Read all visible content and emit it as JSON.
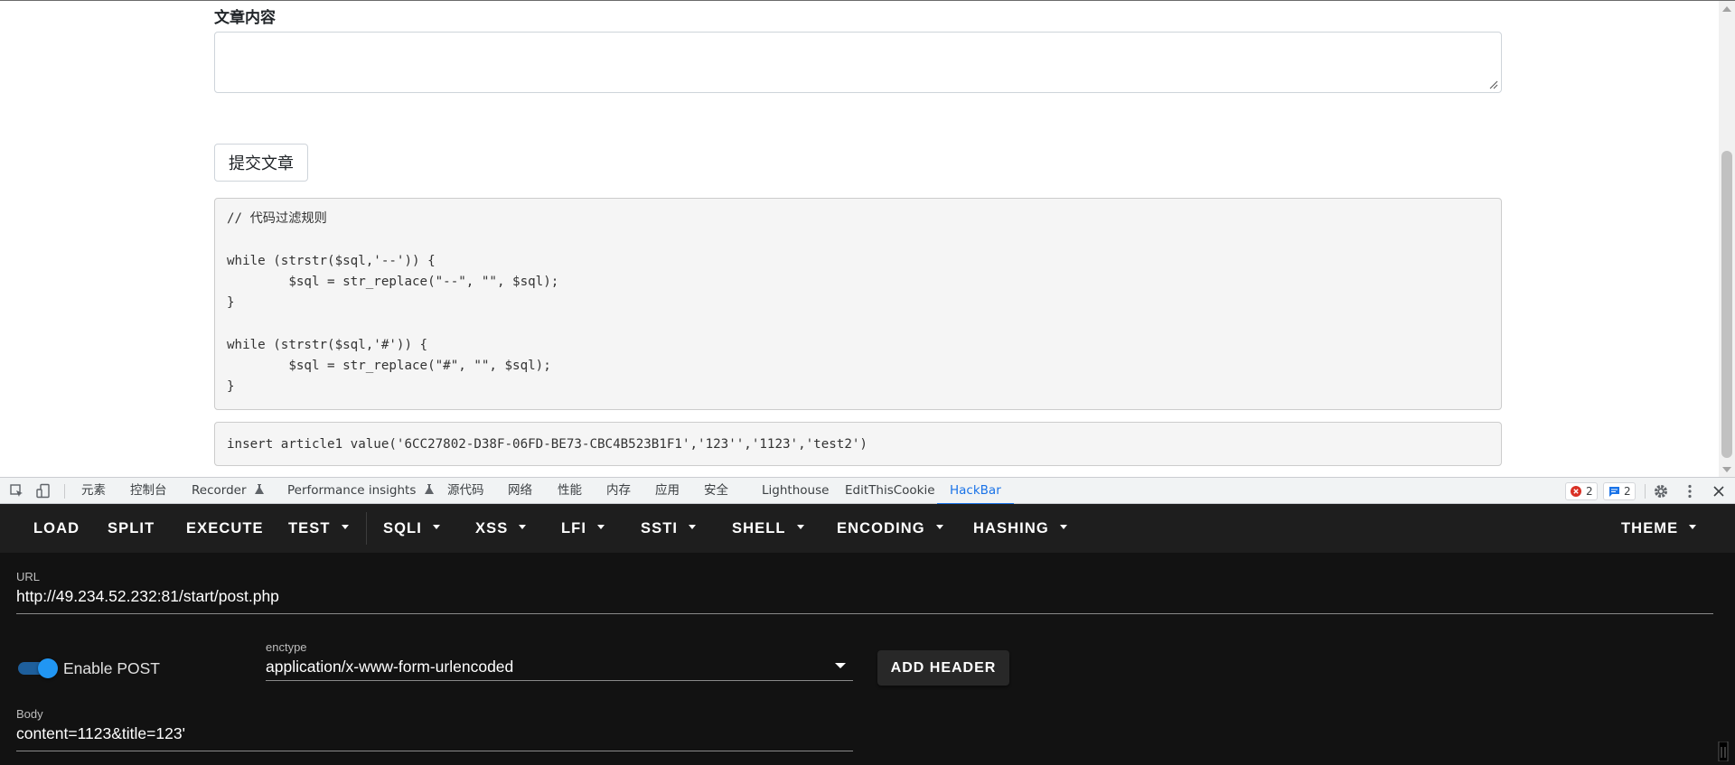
{
  "page": {
    "content_label": "文章内容",
    "content_value": "",
    "submit_label": "提交文章",
    "code_rules": "// 代码过滤规则\n\nwhile (strstr($sql,'--')) {\n        $sql = str_replace(\"--\", \"\", $sql);\n}\n\nwhile (strstr($sql,'#')) {\n        $sql = str_replace(\"#\", \"\", $sql);\n}",
    "sql_query": "insert article1 value('6CC27802-D38F-06FD-BE73-CBC4B523B1F1','123'','1123','test2')"
  },
  "devtools": {
    "tabs": [
      {
        "label": "元素"
      },
      {
        "label": "控制台"
      },
      {
        "label": "Recorder"
      },
      {
        "label": "Performance insights"
      },
      {
        "label": "源代码"
      },
      {
        "label": "网络"
      },
      {
        "label": "性能"
      },
      {
        "label": "内存"
      },
      {
        "label": "应用"
      },
      {
        "label": "安全"
      },
      {
        "label": "Lighthouse"
      },
      {
        "label": "EditThisCookie"
      },
      {
        "label": "HackBar"
      }
    ],
    "active_tab": "HackBar",
    "error_count": "2",
    "message_count": "2",
    "icons": [
      "inspect-element-icon",
      "device-toggle-icon",
      "flask-icon",
      "error-icon",
      "message-icon",
      "gear-icon",
      "more-vert-icon",
      "close-icon"
    ]
  },
  "hackbar": {
    "toolbar": [
      {
        "label": "LOAD"
      },
      {
        "label": "SPLIT"
      },
      {
        "label": "EXECUTE"
      },
      {
        "label": "TEST"
      },
      {
        "label": "SQLI"
      },
      {
        "label": "XSS"
      },
      {
        "label": "LFI"
      },
      {
        "label": "SSTI"
      },
      {
        "label": "SHELL"
      },
      {
        "label": "ENCODING"
      },
      {
        "label": "HASHING"
      },
      {
        "label": "THEME"
      }
    ],
    "url_label": "URL",
    "url_value": "http://49.234.52.232:81/start/post.php",
    "enable_post_label": "Enable POST",
    "enable_post": true,
    "enctype_label": "enctype",
    "enctype_value": "application/x-www-form-urlencoded",
    "add_header_label": "ADD HEADER",
    "body_label": "Body",
    "body_value": "content=1123&title=123'",
    "colors": {
      "accent": "#2196f3",
      "background": "#121212",
      "toolbar": "#1e1e1e"
    }
  }
}
